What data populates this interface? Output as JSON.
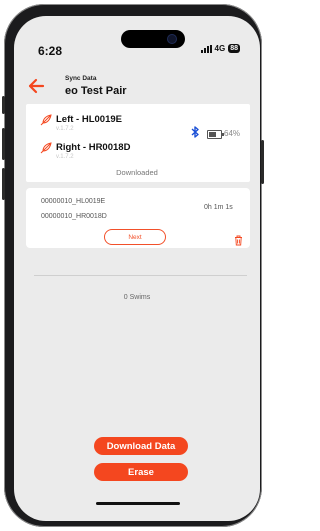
{
  "status_bar": {
    "time": "6:28",
    "network": "4G",
    "battery": "88"
  },
  "header": {
    "sync_label": "Sync Data",
    "device_name": "eo Test Pair"
  },
  "pods": [
    {
      "name": "Left - HL0019E",
      "version": "v.1.7.2"
    },
    {
      "name": "Right - HR0018D",
      "version": "v.1.7.2"
    }
  ],
  "connection": {
    "battery_percent": 0.64,
    "battery_text": "64%"
  },
  "download_status": "Downloaded",
  "session": {
    "files": [
      "00000010_HL0019E",
      "00000010_HR0018D"
    ],
    "duration": "0h 1m 1s",
    "next_label": "Next"
  },
  "swims_text": "0 Swims",
  "actions": {
    "download_label": "Download Data",
    "erase_label": "Erase"
  },
  "colors": {
    "accent": "#f4471f",
    "background": "#ebebeb"
  },
  "icons": [
    "back-arrow-icon",
    "feather-icon",
    "bluetooth-icon",
    "battery-icon",
    "trash-icon"
  ]
}
